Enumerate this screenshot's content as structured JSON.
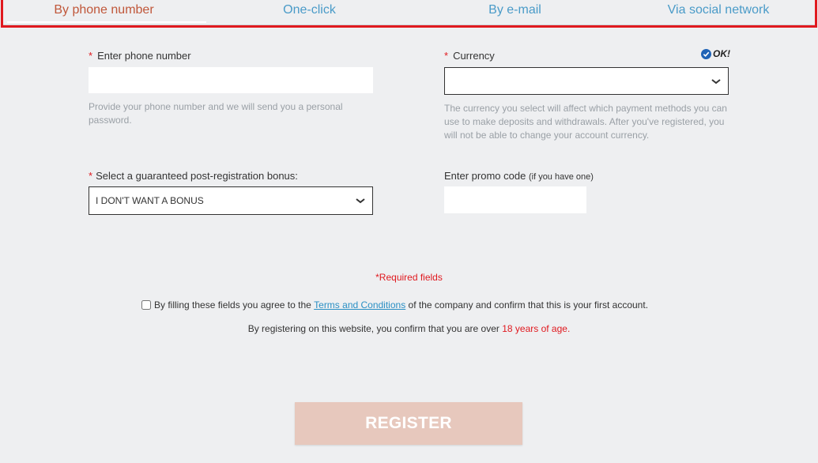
{
  "tabs": [
    {
      "label": "By phone number",
      "active": true
    },
    {
      "label": "One-click",
      "active": false
    },
    {
      "label": "By e-mail",
      "active": false
    },
    {
      "label": "Via social network",
      "active": false
    }
  ],
  "phone": {
    "required_mark": "*",
    "label": "Enter phone number",
    "value": "",
    "help": "Provide your phone number and we will send you a personal password."
  },
  "currency": {
    "required_mark": "*",
    "label": "Currency",
    "selected": "",
    "ok_text": "OK!",
    "help": "The currency you select will affect which payment methods you can use to make deposits and withdrawals. After you've registered, you will not be able to change your account currency."
  },
  "bonus": {
    "required_mark": "*",
    "label": "Select a guaranteed post-registration bonus:",
    "selected": "I DON'T WANT A BONUS"
  },
  "promo": {
    "label": "Enter promo code",
    "label_note": "(if you have one)",
    "value": ""
  },
  "required_note": "*Required fields",
  "agreement": {
    "text_before": "By filling these fields you agree to the",
    "link_text": "Terms and Conditions",
    "text_after": "of the company and confirm that this is your first account.",
    "checked": false
  },
  "age_notice": {
    "text_before": "By registering on this website, you confirm that you are over",
    "highlight": "18 years of age."
  },
  "register_button": "REGISTER",
  "colors": {
    "accent_red": "#e0191f",
    "tab_active": "#c0573a",
    "tab_link": "#4a9bc8",
    "register_bg": "#e7c8bd",
    "ok_blue": "#1f63b6"
  }
}
